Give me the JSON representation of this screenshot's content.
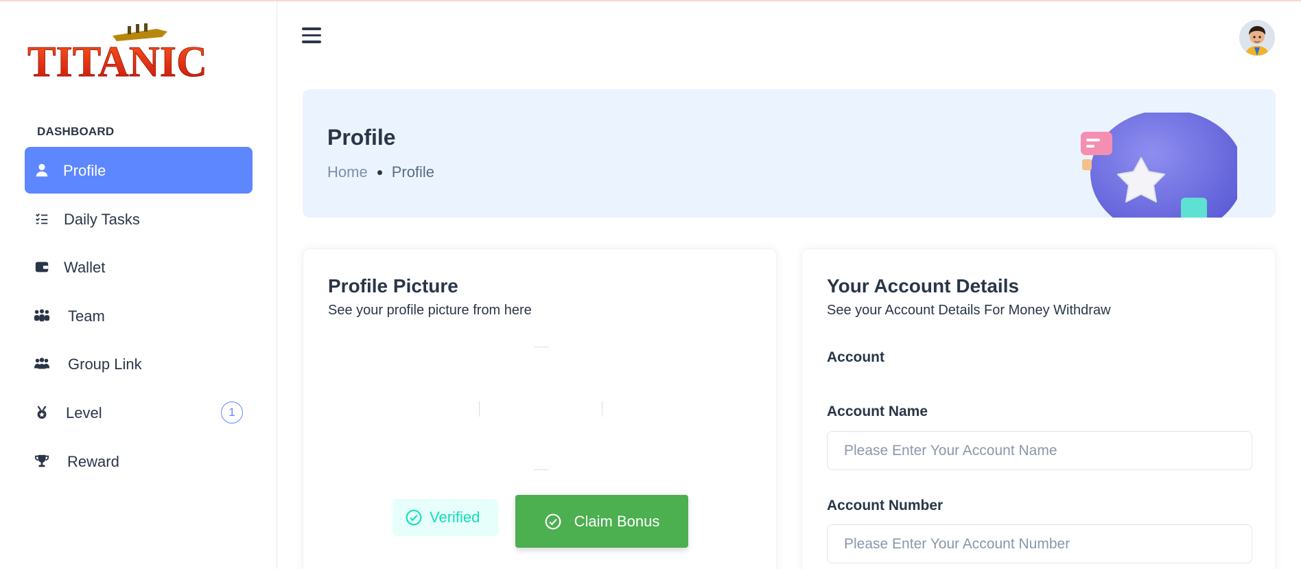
{
  "brand": {
    "logo_text": "TITANIC"
  },
  "sidebar": {
    "section_title": "DASHBOARD",
    "items": [
      {
        "label": "Profile",
        "icon": "user-icon",
        "active": true
      },
      {
        "label": "Daily Tasks",
        "icon": "checklist-icon"
      },
      {
        "label": "Wallet",
        "icon": "wallet-icon"
      },
      {
        "label": "Team",
        "icon": "team-icon"
      },
      {
        "label": "Group Link",
        "icon": "group-icon"
      },
      {
        "label": "Level",
        "icon": "medal-icon",
        "badge": "1"
      },
      {
        "label": "Reward",
        "icon": "trophy-icon"
      }
    ]
  },
  "header": {
    "menu_icon": "hamburger-icon",
    "avatar_icon": "user-avatar"
  },
  "banner": {
    "title": "Profile",
    "breadcrumb": {
      "home": "Home",
      "current": "Profile"
    }
  },
  "profile_card": {
    "title": "Profile Picture",
    "subtitle": "See your profile picture from here",
    "verified_label": "Verified",
    "claim_label": "Claim Bonus"
  },
  "account_card": {
    "title": "Your Account Details",
    "subtitle": "See your Account Details For Money Withdraw",
    "account_label": "Account",
    "account_name_label": "Account Name",
    "account_name_placeholder": "Please Enter Your Account Name",
    "account_number_label": "Account Number",
    "account_number_placeholder": "Please Enter Your Account Number"
  },
  "colors": {
    "accent": "#5d87ff",
    "success": "#4caf50",
    "verified": "#13deb9",
    "banner_bg": "#ebf3fe"
  }
}
